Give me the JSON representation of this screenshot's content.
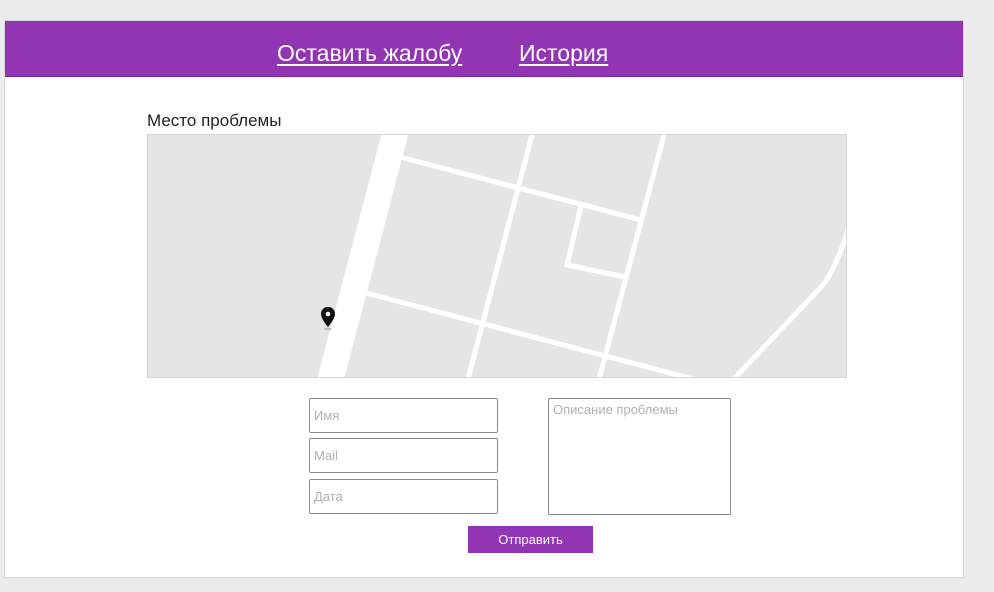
{
  "nav": {
    "complain_label": "Оставить жалобу",
    "history_label": "История"
  },
  "map": {
    "section_label": "Место проблемы",
    "marker_icon": "map-pin-icon"
  },
  "form": {
    "name_placeholder": "Имя",
    "mail_placeholder": "Mail",
    "date_placeholder": "Дата",
    "description_placeholder": "Описание проблемы",
    "submit_label": "Отправить"
  },
  "colors": {
    "accent": "#9135b5",
    "page_background": "#ececec",
    "map_background": "#e5e5e5"
  }
}
